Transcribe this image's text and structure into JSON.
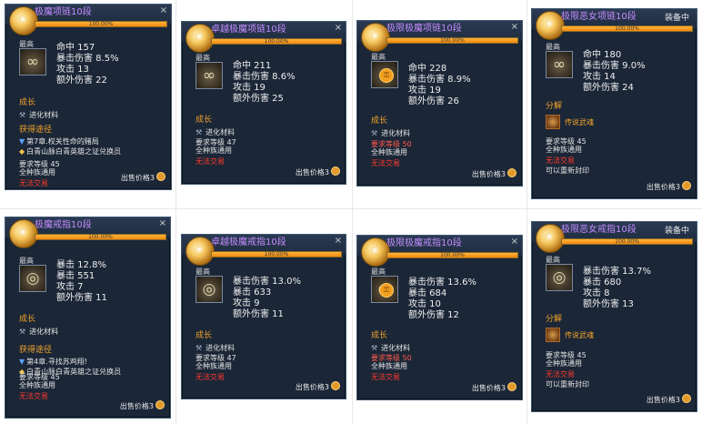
{
  "colors": {
    "title": "#c58cff",
    "section": "#f0a22a",
    "warning": "#ff3a2a",
    "bar": "#f08a10",
    "panel": "#1b2637"
  },
  "common": {
    "growth_label": "成长",
    "material_label": "进化材料",
    "material_icon": "hammer-icon",
    "acquire_label": "获得途径",
    "race_text": "全种族通用",
    "no_trade": "无法交易",
    "price_label": "出售价格3",
    "grade": "最高",
    "close": "×",
    "equipped": "装备中",
    "decompose_label": "分解",
    "legend_soul": "传说武魂",
    "rebind_text": "可以重新封印"
  },
  "tooltips": [
    {
      "title": "极魔项链10段",
      "progress": "100.00%",
      "progress_value": 1.0,
      "icon": "necklace-icon",
      "locked": false,
      "equipped": false,
      "stats": [
        "命中 157",
        "暴击伤害 8.5%",
        "攻击 13",
        "额外伤害 22"
      ],
      "routes": [
        "第7章.权关性命的赌局",
        "白青山脉白青英雄之证兑换员"
      ],
      "req_level": "要求等级 45",
      "req_red": false
    },
    {
      "title": "卓越极魔项链10段",
      "progress": "100.00%",
      "progress_value": 1.0,
      "icon": "necklace-icon",
      "locked": false,
      "equipped": false,
      "stats": [
        "命中 211",
        "暴击伤害 8.6%",
        "攻击 19",
        "额外伤害 25"
      ],
      "routes": [],
      "req_level": "要求等级 47",
      "req_red": false
    },
    {
      "title": "极限极魔项链10段",
      "progress": "100.00%",
      "progress_value": 1.0,
      "icon": "necklace-icon",
      "locked": true,
      "equipped": false,
      "stats": [
        "命中 228",
        "暴击伤害 8.9%",
        "攻击 19",
        "额外伤害 26"
      ],
      "routes": [],
      "req_level": "要求等级 50",
      "req_red": true
    },
    {
      "title": "极限恶女项链10段",
      "progress": "100.00%",
      "progress_value": 1.0,
      "icon": "necklace-icon",
      "locked": false,
      "equipped": true,
      "stats": [
        "命中 180",
        "暴击伤害 9.0%",
        "攻击 14",
        "额外伤害 24"
      ],
      "routes": [],
      "req_level": "要求等级 45",
      "req_red": false
    },
    {
      "title": "极魔戒指10段",
      "progress": "100.00%",
      "progress_value": 1.0,
      "icon": "ring-icon",
      "locked": false,
      "equipped": false,
      "stats": [
        "暴击 12.8%",
        "暴击 551",
        "攻击 7",
        "额外伤害 11"
      ],
      "routes": [
        "第4章.寻找苏鸡翔!",
        "白青山脉白青英雄之证兑换员"
      ],
      "req_level": "要求等级 45",
      "req_red": false
    },
    {
      "title": "卓越极魔戒指10段",
      "progress": "100.00%",
      "progress_value": 1.0,
      "icon": "ring-icon",
      "locked": false,
      "equipped": false,
      "stats": [
        "暴击伤害 13.0%",
        "暴击 633",
        "攻击 9",
        "额外伤害 11"
      ],
      "routes": [],
      "req_level": "要求等级 47",
      "req_red": false
    },
    {
      "title": "极限极魔戒指10段",
      "progress": "100.00%",
      "progress_value": 1.0,
      "icon": "ring-icon",
      "locked": true,
      "equipped": false,
      "stats": [
        "暴击伤害 13.6%",
        "暴击 684",
        "攻击 10",
        "额外伤害 12"
      ],
      "routes": [],
      "req_level": "要求等级 50",
      "req_red": true
    },
    {
      "title": "极限恶女戒指10段",
      "progress": "100.00%",
      "progress_value": 1.0,
      "icon": "ring-icon",
      "locked": false,
      "equipped": true,
      "stats": [
        "暴击伤害 13.7%",
        "暴击 680",
        "攻击 8",
        "额外伤害 13"
      ],
      "routes": [],
      "req_level": "要求等级 45",
      "req_red": false
    }
  ]
}
